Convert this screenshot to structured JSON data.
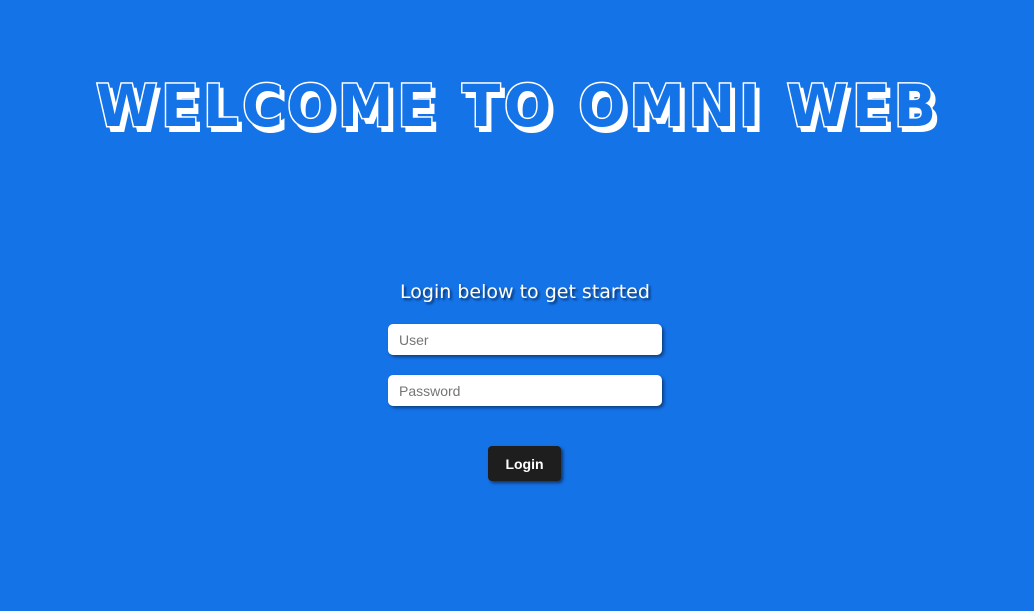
{
  "page": {
    "background_color": "#1573e8",
    "headline": "WELCOME TO OMNI WEB",
    "subtitle": "Login below to get started"
  },
  "form": {
    "user_placeholder": "User",
    "user_value": "",
    "password_placeholder": "Password",
    "password_value": "",
    "login_label": "Login",
    "login_button_color": "#1e1e1e"
  }
}
